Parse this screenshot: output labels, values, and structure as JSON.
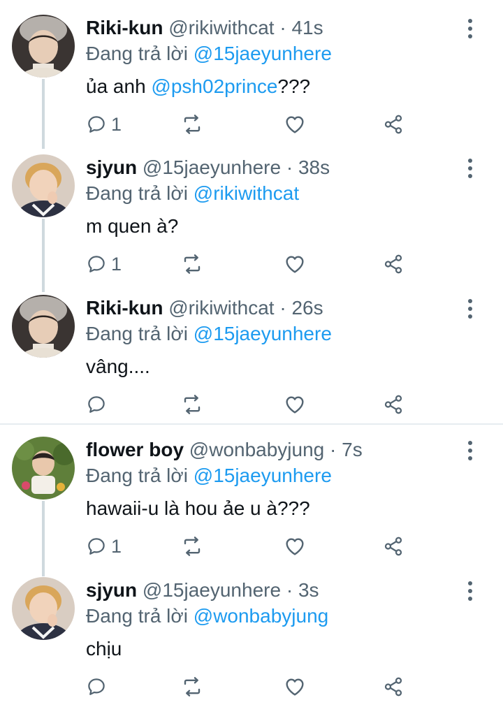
{
  "replying_prefix": "Đang trả lời",
  "tweets": [
    {
      "name": "Riki-kun",
      "handle": "@rikiwithcat",
      "time": "41s",
      "reply_to": "@15jaeyunhere",
      "text": "ủa anh ",
      "mention": "@psh02prince",
      "text_after": "???",
      "reply_count": "1"
    },
    {
      "name": "sjyun",
      "handle": "@15jaeyunhere",
      "time": "38s",
      "reply_to": "@rikiwithcat",
      "text": "m quen à?",
      "reply_count": "1"
    },
    {
      "name": "Riki-kun",
      "handle": "@rikiwithcat",
      "time": "26s",
      "reply_to": "@15jaeyunhere",
      "text": "vâng....",
      "reply_count": ""
    },
    {
      "name": "flower boy",
      "handle": "@wonbabyjung",
      "time": "7s",
      "reply_to": "@15jaeyunhere",
      "text": "hawaii-u là hou ảe u à???",
      "reply_count": "1"
    },
    {
      "name": "sjyun",
      "handle": "@15jaeyunhere",
      "time": "3s",
      "reply_to": "@wonbabyjung",
      "text": "chịu",
      "reply_count": ""
    }
  ],
  "icons": {
    "reply": "reply-icon",
    "retweet": "retweet-icon",
    "like": "heart-icon",
    "share": "share-icon",
    "more": "more-vertical-icon"
  },
  "colors": {
    "link": "#1d9bf0",
    "secondary": "#536471",
    "thread_line": "#cfd9de"
  }
}
